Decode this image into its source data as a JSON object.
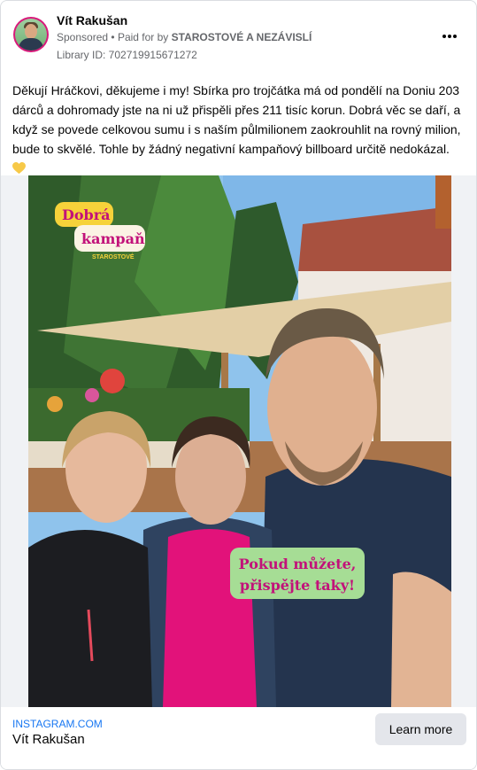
{
  "post": {
    "author": "Vít Rakušan",
    "sponsored_label": "Sponsored",
    "separator": "•",
    "paid_prefix": "Paid for by",
    "paid_by": "STAROSTOVÉ A NEZÁVISLÍ",
    "library_id": "Library ID: 702719915671272",
    "more_icon": "more-horizontal-icon",
    "text": "Děkují Hráčkovi, děkujeme i my! Sbírka pro trojčátka má od pondělí na Doniu 203 dárců a dohromady jste na ni už přispěli přes 211 tisíc korun. Dobrá věc se daří, a když se povede celkovou sumu i s naším půlmilionem zaokrouhlit na rovný milion, bude to skvělé. Tohle by žádný negativní kampaňový billboard určitě nedokázal.",
    "emoji_icon": "yellow-heart-icon"
  },
  "image": {
    "badge_line1": "Dobrá",
    "badge_line2": "kampaň",
    "badge_brand": "STAROSTOVÉ",
    "callout_line1": "Pokud můžete,",
    "callout_line2": "přispějte taky!"
  },
  "link": {
    "source": "INSTAGRAM.COM",
    "title": "Vít Rakušan",
    "cta": "Learn more"
  },
  "colors": {
    "accent_pink": "#d8197a",
    "badge_yellow": "#f6d23a",
    "badge_text": "#c2127a",
    "callout_green": "#a6dd95",
    "link_blue": "#1877f2"
  }
}
